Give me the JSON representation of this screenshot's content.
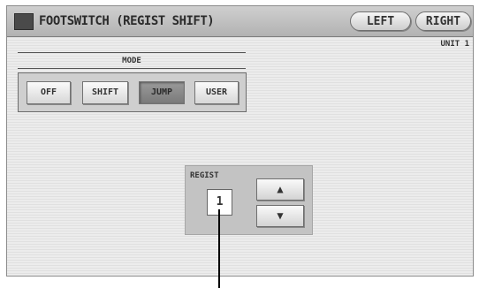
{
  "title": "FOOTSWITCH (REGIST SHIFT)",
  "nav": {
    "left_label": "LEFT",
    "right_label": "RIGHT"
  },
  "unit_label": "UNIT 1",
  "mode": {
    "label": "MODE",
    "options": [
      "OFF",
      "SHIFT",
      "JUMP",
      "USER"
    ],
    "selected": "JUMP"
  },
  "regist": {
    "label": "REGIST",
    "value": "1",
    "up_icon": "▲",
    "down_icon": "▼"
  }
}
